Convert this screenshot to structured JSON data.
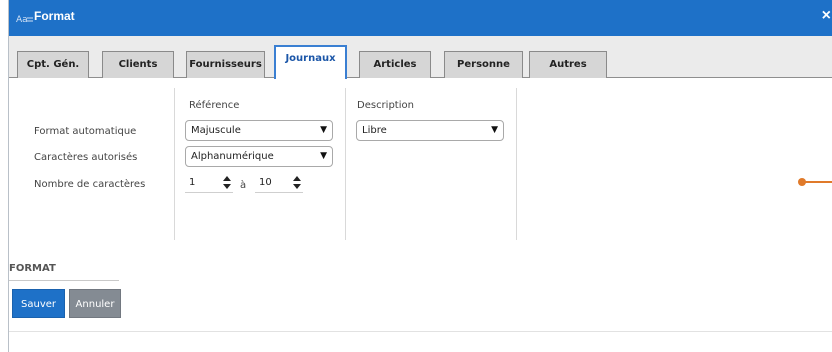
{
  "window": {
    "title": "Format",
    "icon": "format-app-icon",
    "close_label": "×"
  },
  "tabs": [
    {
      "label": "Cpt. Gén.",
      "active": false
    },
    {
      "label": "Clients",
      "active": false
    },
    {
      "label": "Fournisseurs",
      "active": false
    },
    {
      "label": "Journaux",
      "active": true
    },
    {
      "label": "Articles",
      "active": false
    },
    {
      "label": "Personne",
      "active": false
    },
    {
      "label": "Autres",
      "active": false
    }
  ],
  "form": {
    "headers": {
      "reference": "Référence",
      "description": "Description"
    },
    "rows": {
      "format_auto": "Format automatique",
      "allowed_chars": "Caractères autorisés",
      "char_count": "Nombre de caractères"
    },
    "reference": {
      "format_auto_value": "Majuscule",
      "allowed_chars_value": "Alphanumérique",
      "min_chars": "1",
      "between_label": "à",
      "max_chars": "10"
    },
    "description": {
      "format_auto_value": "Libre"
    },
    "dropdown_arrow": "▼"
  },
  "section": {
    "title": "FORMAT"
  },
  "buttons": {
    "save": "Sauver",
    "cancel": "Annuler"
  },
  "colors": {
    "titlebar": "#1e71c8",
    "active_tab_border": "#3a7fd2",
    "save_button": "#1e71c8",
    "cancel_button": "#848b93",
    "handle": "#e07a2a"
  }
}
